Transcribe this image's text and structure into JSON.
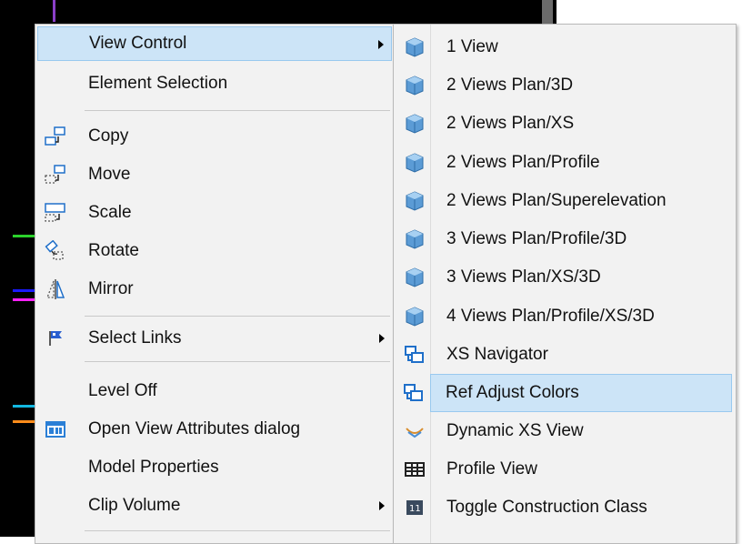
{
  "main_menu": {
    "items": [
      {
        "label": "View Control",
        "has_submenu": true,
        "icon": "",
        "highlighted": true
      },
      {
        "label": "Element Selection",
        "has_submenu": false,
        "icon": ""
      },
      {
        "label": "Copy",
        "has_submenu": false,
        "icon": "copy-icon"
      },
      {
        "label": "Move",
        "has_submenu": false,
        "icon": "move-icon"
      },
      {
        "label": "Scale",
        "has_submenu": false,
        "icon": "scale-icon"
      },
      {
        "label": "Rotate",
        "has_submenu": false,
        "icon": "rotate-icon"
      },
      {
        "label": "Mirror",
        "has_submenu": false,
        "icon": "mirror-icon"
      },
      {
        "label": "Select Links",
        "has_submenu": true,
        "icon": "select-links-icon"
      },
      {
        "label": "Level Off",
        "has_submenu": false,
        "icon": ""
      },
      {
        "label": "Open View Attributes dialog",
        "has_submenu": false,
        "icon": "view-attributes-icon"
      },
      {
        "label": "Model Properties",
        "has_submenu": false,
        "icon": ""
      },
      {
        "label": "Clip Volume",
        "has_submenu": true,
        "icon": ""
      }
    ]
  },
  "submenu": {
    "items": [
      {
        "label": "1 View",
        "icon": "cube-icon"
      },
      {
        "label": "2 Views Plan/3D",
        "icon": "cube-icon"
      },
      {
        "label": "2 Views Plan/XS",
        "icon": "cube-icon"
      },
      {
        "label": "2 Views Plan/Profile",
        "icon": "cube-icon"
      },
      {
        "label": "2 Views Plan/Superelevation",
        "icon": "cube-icon"
      },
      {
        "label": "3 Views Plan/Profile/3D",
        "icon": "cube-icon"
      },
      {
        "label": "3 Views Plan/XS/3D",
        "icon": "cube-icon"
      },
      {
        "label": "4 Views Plan/Profile/XS/3D",
        "icon": "cube-icon"
      },
      {
        "label": "XS Navigator",
        "icon": "xs-navigator-icon"
      },
      {
        "label": "Ref Adjust Colors",
        "icon": "ref-adjust-colors-icon",
        "highlighted": true
      },
      {
        "label": "Dynamic XS View",
        "icon": "dynamic-xs-icon"
      },
      {
        "label": "Profile View",
        "icon": "profile-view-icon"
      },
      {
        "label": "Toggle Construction Class",
        "icon": "construction-class-icon"
      }
    ]
  },
  "colors": {
    "menu_bg": "#f2f2f2",
    "highlight_bg": "#cce4f7",
    "highlight_border": "#99c9ef",
    "cube_blue": "#5b9bd5"
  }
}
